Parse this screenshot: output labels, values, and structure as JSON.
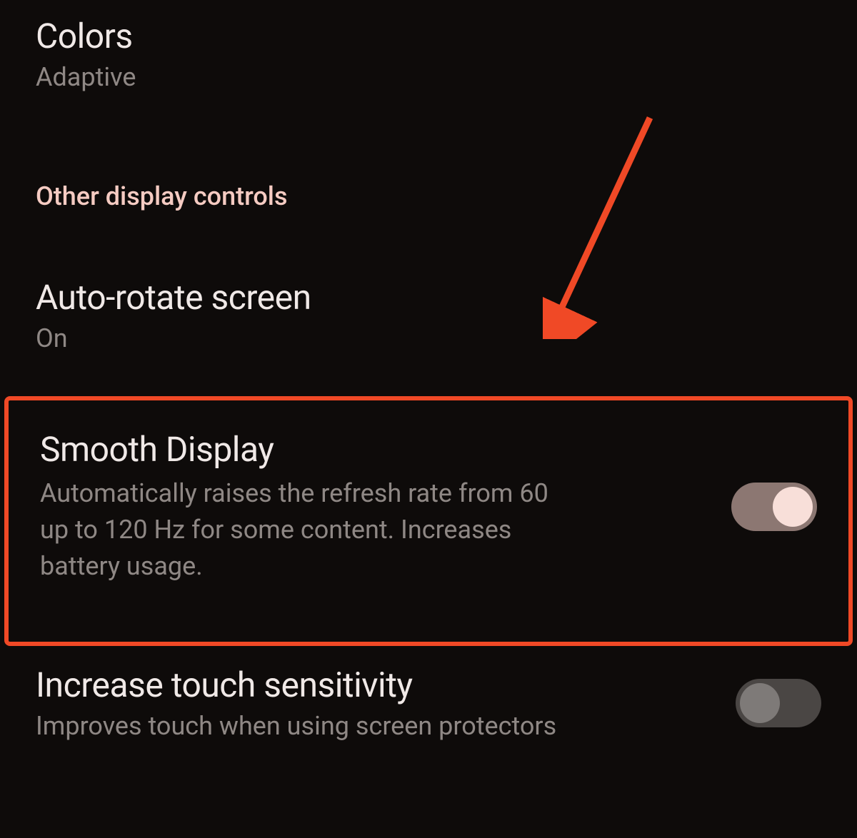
{
  "colors": {
    "title": "Colors",
    "value": "Adaptive"
  },
  "section_header": "Other display controls",
  "auto_rotate": {
    "title": "Auto-rotate screen",
    "value": "On"
  },
  "smooth_display": {
    "title": "Smooth Display",
    "description": "Automatically raises the refresh rate from 60 up to 120 Hz for some content. Increases battery usage.",
    "enabled": true
  },
  "touch_sensitivity": {
    "title": "Increase touch sensitivity",
    "description": "Improves touch when using screen protectors",
    "enabled": false
  },
  "annotation": {
    "arrow_color": "#f04926",
    "highlight_color": "#f04926"
  }
}
